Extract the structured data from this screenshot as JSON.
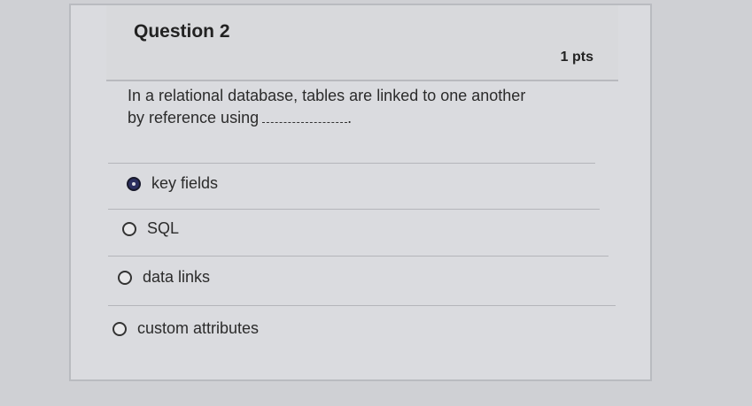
{
  "question": {
    "title": "Question 2",
    "points": "1 pts",
    "text": "In a relational database, tables are linked to one another by reference using"
  },
  "answers": [
    {
      "label": "key fields",
      "selected": true
    },
    {
      "label": "SQL",
      "selected": false
    },
    {
      "label": "data links",
      "selected": false
    },
    {
      "label": "custom attributes",
      "selected": false
    }
  ],
  "icons": {
    "bookmark": "bookmark-icon",
    "radio": "radio-icon"
  },
  "colors": {
    "selected_radio": "#2b2f5f",
    "background": "#cfd0d4"
  }
}
